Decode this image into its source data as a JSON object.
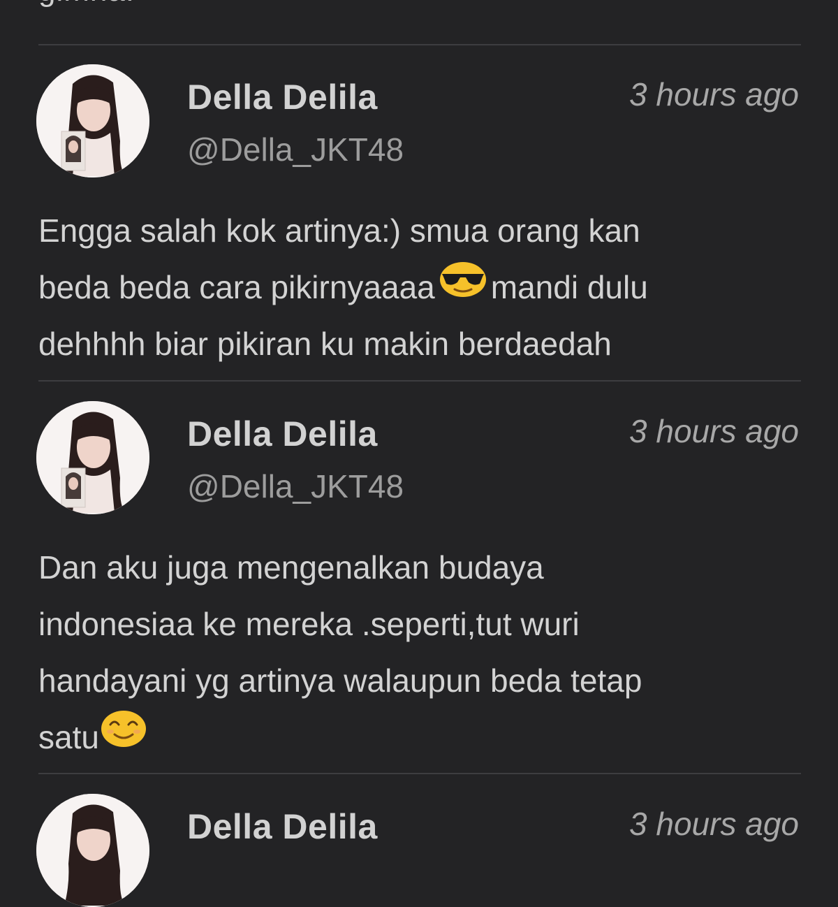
{
  "top_fragment": "gimna!",
  "posts": [
    {
      "name": "Della Delila",
      "handle": "@Della_JKT48",
      "time": "3 hours ago",
      "lines": [
        "Engga salah kok artinya:) smua orang kan",
        "beda beda cara pikirnyaaaa",
        "mandi dulu",
        "dehhhh biar pikiran ku makin berdaedah"
      ],
      "emoji": [
        "smiling-face-with-sunglasses"
      ]
    },
    {
      "name": "Della Delila",
      "handle": "@Della_JKT48",
      "time": "3 hours ago",
      "lines": [
        "Dan aku juga mengenalkan budaya",
        "indonesiaa ke mereka .seperti,tut wuri",
        "handayani yg artinya walaupun beda tetap",
        "satu"
      ],
      "emoji": [
        "smiling-face-with-smiling-eyes"
      ]
    },
    {
      "name": "Della Delila",
      "time": "3 hours ago"
    }
  ],
  "colors": {
    "background": "#232325",
    "divider": "#3d3d40",
    "name": "#d2d2d2",
    "secondary": "#9d9d9d",
    "emoji": "#f6c12a"
  }
}
